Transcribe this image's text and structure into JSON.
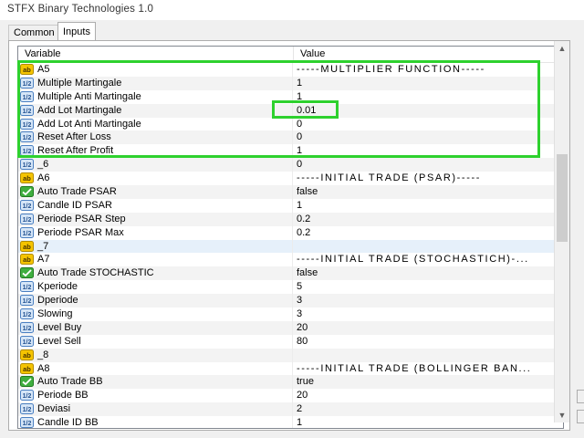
{
  "window": {
    "title": "STFX Binary Technologies 1.0"
  },
  "tabs": [
    {
      "label": "Common"
    },
    {
      "label": "Inputs"
    }
  ],
  "grid": {
    "columns": {
      "variable": "Variable",
      "value": "Value"
    },
    "rows": [
      {
        "icon": "ab-icon",
        "name": "A5",
        "value": "-----MULTIPLIER   FUNCTION-----"
      },
      {
        "icon": "number-icon",
        "name": "Multiple Martingale",
        "value": "1"
      },
      {
        "icon": "number-icon",
        "name": "Multiple Anti Martingale",
        "value": "1"
      },
      {
        "icon": "number-icon",
        "name": "Add Lot Martingale",
        "value": "0.01"
      },
      {
        "icon": "number-icon",
        "name": "Add Lot Anti Martingale",
        "value": "0"
      },
      {
        "icon": "number-icon",
        "name": "Reset After Loss",
        "value": "0"
      },
      {
        "icon": "number-icon",
        "name": "Reset After Profit",
        "value": "1"
      },
      {
        "icon": "number-icon",
        "name": "_6",
        "value": "0"
      },
      {
        "icon": "ab-icon",
        "name": "A6",
        "value": "-----INITIAL TRADE (PSAR)-----"
      },
      {
        "icon": "bool-icon",
        "name": "Auto Trade PSAR",
        "value": "false"
      },
      {
        "icon": "number-icon",
        "name": "Candle ID PSAR",
        "value": "1"
      },
      {
        "icon": "number-icon",
        "name": "Periode PSAR Step",
        "value": "0.2"
      },
      {
        "icon": "number-icon",
        "name": "Periode PSAR Max",
        "value": "0.2"
      },
      {
        "icon": "ab-icon",
        "name": "_7",
        "value": ""
      },
      {
        "icon": "ab-icon",
        "name": "A7",
        "value": "-----INITIAL TRADE (STOCHASTICH)-..."
      },
      {
        "icon": "bool-icon",
        "name": "Auto Trade STOCHASTIC",
        "value": "false"
      },
      {
        "icon": "number-icon",
        "name": "Kperiode",
        "value": "5"
      },
      {
        "icon": "number-icon",
        "name": "Dperiode",
        "value": "3"
      },
      {
        "icon": "number-icon",
        "name": "Slowing",
        "value": "3"
      },
      {
        "icon": "number-icon",
        "name": "Level Buy",
        "value": "20"
      },
      {
        "icon": "number-icon",
        "name": "Level Sell",
        "value": "80"
      },
      {
        "icon": "ab-icon",
        "name": "_8",
        "value": ""
      },
      {
        "icon": "ab-icon",
        "name": "A8",
        "value": "-----INITIAL TRADE (BOLLINGER BAN..."
      },
      {
        "icon": "bool-icon",
        "name": "Auto Trade BB",
        "value": "true"
      },
      {
        "icon": "number-icon",
        "name": "Periode BB",
        "value": "20"
      },
      {
        "icon": "number-icon",
        "name": "Deviasi",
        "value": "2"
      },
      {
        "icon": "number-icon",
        "name": "Candle ID BB",
        "value": "1"
      }
    ]
  },
  "colors": {
    "highlight": "#2ed12e",
    "selected_row": "#e6f0fa"
  }
}
